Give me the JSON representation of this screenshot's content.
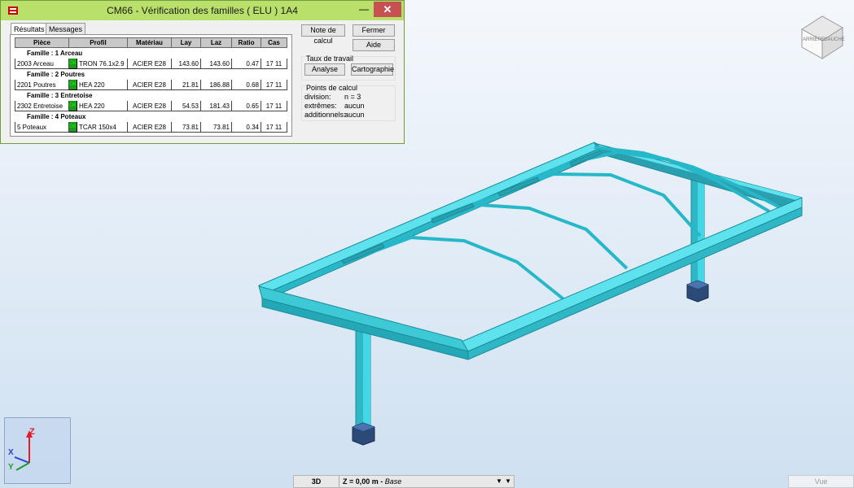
{
  "dialog": {
    "title": "CM66 - Vérification des familles ( ELU ) 1A4",
    "minimize_glyph": "—",
    "close_glyph": "✕",
    "tabs": [
      "Résultats",
      "Messages"
    ],
    "table": {
      "headers": [
        "Pièce",
        "Profil",
        "Matériau",
        "Lay",
        "Laz",
        "Ratio",
        "Cas"
      ],
      "families": [
        {
          "label": "Famille :  1  Arceau",
          "row": {
            "piece": "2003  Arceau",
            "status": "OK",
            "profil": "TRON 76.1x2.9",
            "materiau": "ACIER E28",
            "lay": "143.60",
            "laz": "143.60",
            "ratio": "0.47",
            "cas": "17 11"
          }
        },
        {
          "label": "Famille :  2  Poutres",
          "row": {
            "piece": "2201  Poutres",
            "status": "OK",
            "profil": "HEA 220",
            "materiau": "ACIER E28",
            "lay": "21.81",
            "laz": "186.88",
            "ratio": "0.68",
            "cas": "17 11"
          }
        },
        {
          "label": "Famille :  3  Entretoise",
          "row": {
            "piece": "2302  Entretoise",
            "status": "OK",
            "profil": "HEA 220",
            "materiau": "ACIER E28",
            "lay": "54.53",
            "laz": "181.43",
            "ratio": "0.65",
            "cas": "17 11"
          }
        },
        {
          "label": "Famille :  4  Poteaux",
          "row": {
            "piece": "5  Poteaux",
            "status": "OK",
            "profil": "TCAR 150x4",
            "materiau": "ACIER E28",
            "lay": "73.81",
            "laz": "73.81",
            "ratio": "0.34",
            "cas": "17 11"
          }
        }
      ]
    },
    "buttons": {
      "note": "Note de calcul",
      "fermer": "Fermer",
      "aide": "Aide",
      "analyse": "Analyse",
      "cartographie": "Cartographie"
    },
    "taux_title": "Taux de travail",
    "points": {
      "title": "Points de calcul",
      "division_label": "division:",
      "division_value": "n = 3",
      "extremes_label": "extrêmes:",
      "extremes_value": "aucun",
      "additionnels_label": "additionnels:",
      "additionnels_value": "aucun"
    }
  },
  "statusbar": {
    "view": "3D",
    "plane_prefix": "Z = 0,00 m - ",
    "plane_name": "Base"
  },
  "view_button": "Vue",
  "viewcube": {
    "faces": [
      "ARRIÈRE",
      "GAUCHE"
    ]
  },
  "axes": {
    "z": "Z",
    "x": "X",
    "y": "Y"
  },
  "colors": {
    "steel": "#3ad2e0",
    "steel_dark": "#1a8d9a",
    "titlebar": "#b9e06a",
    "ok": "#1f9a1f",
    "support": "#2c4a78"
  }
}
